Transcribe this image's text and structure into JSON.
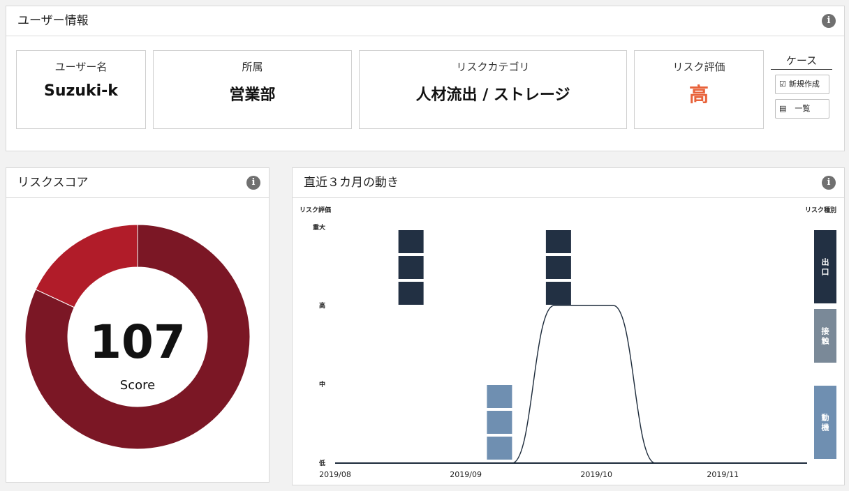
{
  "user_panel": {
    "title": "ユーザー情報",
    "info_icon": "i",
    "cards": [
      {
        "label": "ユーザー名",
        "value": "Suzuki-k"
      },
      {
        "label": "所属",
        "value": "営業部"
      },
      {
        "label": "リスクカテゴリ",
        "value": "人材流出 / ストレージ"
      },
      {
        "label": "リスク評価",
        "value": "高"
      }
    ],
    "case": {
      "title": "ケース",
      "new_label": "新規作成",
      "new_icon": "checkbox-edit-icon",
      "list_label": "一覧",
      "list_icon": "list-icon"
    },
    "high_color": "#e8623a"
  },
  "score_panel": {
    "title": "リスクスコア",
    "info_icon": "i",
    "score": "107",
    "score_label": "Score",
    "colors": {
      "major": "#7b1725",
      "minor": "#b11c29"
    }
  },
  "trend_panel": {
    "title": "直近３カ月の動き",
    "info_icon": "i",
    "left_axis_title": "リスク評価",
    "right_axis_title": "リスク種別",
    "legend": [
      {
        "label": "出口",
        "color": "#223043"
      },
      {
        "label": "接触",
        "color": "#7a8998"
      },
      {
        "label": "動機",
        "color": "#6f8fb1"
      }
    ]
  },
  "chart_data": {
    "type": "line",
    "y_levels": [
      "低",
      "中",
      "高",
      "重大"
    ],
    "x_ticks": [
      "2019/08",
      "2019/09",
      "2019/10",
      "2019/11"
    ],
    "x_range_days": [
      0,
      112
    ],
    "line": [
      {
        "x": 0,
        "y": 0
      },
      {
        "x": 42,
        "y": 0
      },
      {
        "x": 52,
        "y": 2
      },
      {
        "x": 66,
        "y": 2
      },
      {
        "x": 76,
        "y": 0
      },
      {
        "x": 112,
        "y": 0
      }
    ],
    "block_groups": [
      {
        "x": 18,
        "type": "出口",
        "count": 3
      },
      {
        "x": 39,
        "type": "動機",
        "count": 3
      },
      {
        "x": 53,
        "type": "出口",
        "count": 3
      }
    ]
  }
}
